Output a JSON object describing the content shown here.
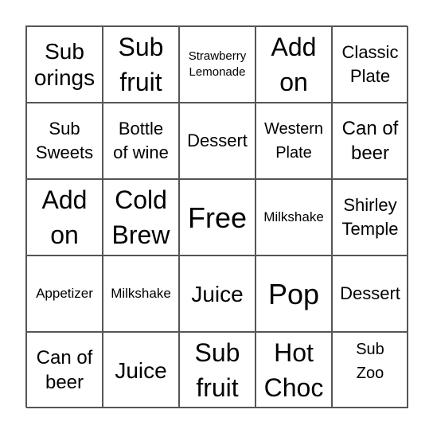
{
  "board": {
    "cells": [
      {
        "text": "Sub\norings",
        "size": "s-ml"
      },
      {
        "text": "Sub\nfruit",
        "size": "s-l"
      },
      {
        "text": "Strawberry\nLemonade",
        "size": "s-xs"
      },
      {
        "text": "Add\non",
        "size": "s-l"
      },
      {
        "text": "Classic\nPlate",
        "size": "s-md"
      },
      {
        "text": "Sub\nSweets",
        "size": "s-md"
      },
      {
        "text": "Bottle\nof wine",
        "size": "s-md"
      },
      {
        "text": "Dessert",
        "size": "s-md"
      },
      {
        "text": "Western\nPlate",
        "size": "s-n"
      },
      {
        "text": "Can of\nbeer",
        "size": "s-m"
      },
      {
        "text": "Add\non",
        "size": "s-l"
      },
      {
        "text": "Cold\nBrew",
        "size": "s-l"
      },
      {
        "text": "Free",
        "size": "s-xl",
        "free": true
      },
      {
        "text": "Milkshake",
        "size": "s-s"
      },
      {
        "text": "Shirley\nTemple",
        "size": "s-md"
      },
      {
        "text": "Appetizer",
        "size": "s-s"
      },
      {
        "text": "Milkshake",
        "size": "s-s"
      },
      {
        "text": "Juice",
        "size": "s-ml"
      },
      {
        "text": "Pop",
        "size": "s-xl"
      },
      {
        "text": "Dessert",
        "size": "s-md"
      },
      {
        "text": "Can of\nbeer",
        "size": "s-m"
      },
      {
        "text": "Juice",
        "size": "s-ml"
      },
      {
        "text": "Sub\nfruit",
        "size": "s-l"
      },
      {
        "text": "Hot\nChoc",
        "size": "s-l"
      },
      {
        "text": "Sub\nZoo",
        "size": "s-n",
        "top": true
      }
    ]
  }
}
